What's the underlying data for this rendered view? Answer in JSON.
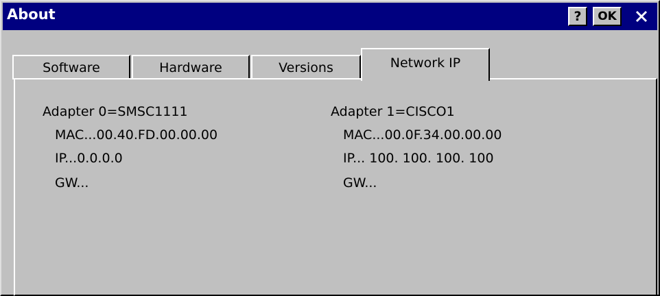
{
  "window": {
    "title": "About",
    "buttons": {
      "help": "?",
      "ok": "OK"
    }
  },
  "tabs": [
    {
      "label": "Software"
    },
    {
      "label": "Hardware"
    },
    {
      "label": "Versions"
    },
    {
      "label": "Network IP",
      "active": true
    }
  ],
  "adapters": [
    {
      "header": "Adapter 0=SMSC1111",
      "mac": "MAC...00.40.FD.00.00.00",
      "ip": "IP...0.0.0.0",
      "gw": "GW..."
    },
    {
      "header": "Adapter 1=CISCO1",
      "mac": "MAC...00.0F.34.00.00.00",
      "ip": "IP... 100. 100. 100. 100",
      "gw": "GW..."
    }
  ],
  "colors": {
    "titlebar": "#000080",
    "face": "#c0c0c0"
  },
  "icons": {
    "close": "close-icon"
  }
}
